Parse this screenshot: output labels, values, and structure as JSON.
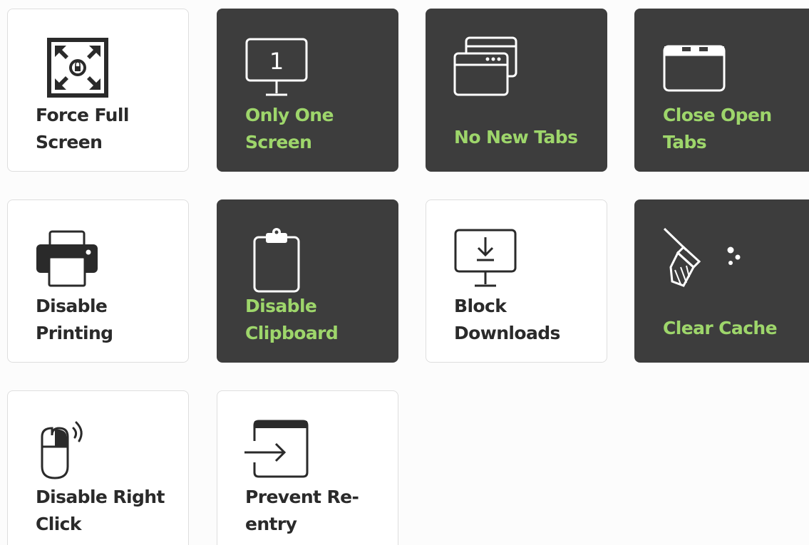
{
  "colors": {
    "tile_on_bg": "#3d3d3d",
    "tile_off_bg": "#ffffff",
    "label_on": "#9ed66b",
    "label_off": "#2a2a2a",
    "page_bg": "#fcfcfc"
  },
  "tiles": [
    {
      "label": "Force Full\nScreen",
      "icon": "fullscreen-lock-icon",
      "active": false
    },
    {
      "label": "Only One\nScreen",
      "icon": "single-monitor-icon",
      "active": true,
      "icon_text": "1"
    },
    {
      "label": "No New Tabs",
      "icon": "browser-windows-icon",
      "active": true
    },
    {
      "label": "Close Open\nTabs",
      "icon": "browser-tabs-icon",
      "active": true
    },
    {
      "label": "Disable\nPrinting",
      "icon": "printer-icon",
      "active": false
    },
    {
      "label": "Disable\nClipboard",
      "icon": "clipboard-icon",
      "active": true
    },
    {
      "label": "Block\nDownloads",
      "icon": "monitor-download-icon",
      "active": false
    },
    {
      "label": "Clear Cache",
      "icon": "broom-icon",
      "active": true
    },
    {
      "label": "Disable Right\nClick",
      "icon": "mouse-right-click-icon",
      "active": false
    },
    {
      "label": "Prevent Re-\nentry",
      "icon": "exit-window-icon",
      "active": false
    }
  ]
}
